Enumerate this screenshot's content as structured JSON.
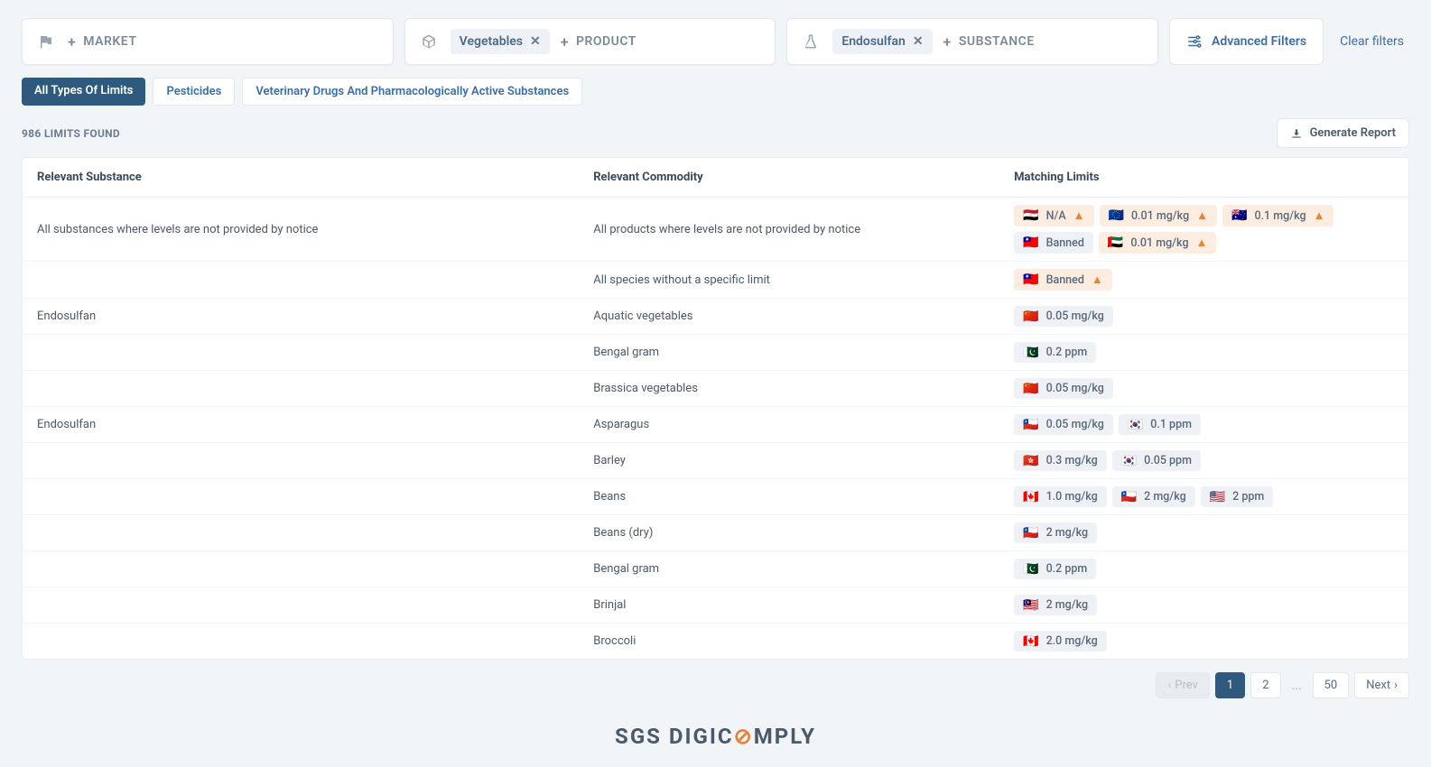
{
  "filters": {
    "market": {
      "placeholder": "MARKET"
    },
    "product": {
      "chip": "Vegetables",
      "placeholder": "PRODUCT"
    },
    "substance": {
      "chip": "Endosulfan",
      "placeholder": "SUBSTANCE"
    },
    "advanced_label": "Advanced Filters",
    "clear_label": "Clear filters"
  },
  "tabs": [
    {
      "label": "All Types Of Limits",
      "active": true
    },
    {
      "label": "Pesticides",
      "active": false
    },
    {
      "label": "Veterinary Drugs And Pharmacologically Active Substances",
      "active": false
    }
  ],
  "count_label": "986 LIMITS FOUND",
  "generate_label": "Generate Report",
  "columns": {
    "substance": "Relevant Substance",
    "commodity": "Relevant Commodity",
    "limits": "Matching Limits"
  },
  "rows": [
    {
      "substance": "All substances where levels are not provided by notice",
      "commodity": "All products where levels are not provided by notice",
      "limits": [
        {
          "flag": "🇪🇬",
          "value": "N/A",
          "warn": true
        },
        {
          "flag": "🇪🇺",
          "value": "0.01 mg/kg",
          "warn": true
        },
        {
          "flag": "🇦🇺",
          "value": "0.1 mg/kg",
          "warn": true
        },
        {
          "flag": "🇹🇼",
          "value": "Banned",
          "warn": false
        },
        {
          "flag": "🇦🇪",
          "value": "0.01 mg/kg",
          "warn": true
        }
      ]
    },
    {
      "substance": "",
      "commodity": "All species without a specific limit",
      "limits": [
        {
          "flag": "🇹🇼",
          "value": "Banned",
          "warn": true
        }
      ]
    },
    {
      "substance": "Endosulfan",
      "commodity": "Aquatic vegetables",
      "limits": [
        {
          "flag": "🇨🇳",
          "value": "0.05 mg/kg",
          "warn": false
        }
      ]
    },
    {
      "substance": "",
      "commodity": "Bengal gram",
      "limits": [
        {
          "flag": "🇵🇰",
          "value": "0.2 ppm",
          "warn": false
        }
      ]
    },
    {
      "substance": "",
      "commodity": "Brassica vegetables",
      "limits": [
        {
          "flag": "🇨🇳",
          "value": "0.05 mg/kg",
          "warn": false
        }
      ]
    },
    {
      "substance": "Endosulfan",
      "commodity": "Asparagus",
      "limits": [
        {
          "flag": "🇨🇱",
          "value": "0.05 mg/kg",
          "warn": false
        },
        {
          "flag": "🇰🇷",
          "value": "0.1 ppm",
          "warn": false
        }
      ]
    },
    {
      "substance": "",
      "commodity": "Barley",
      "limits": [
        {
          "flag": "🇭🇰",
          "value": "0.3 mg/kg",
          "warn": false
        },
        {
          "flag": "🇰🇷",
          "value": "0.05 ppm",
          "warn": false
        }
      ]
    },
    {
      "substance": "",
      "commodity": "Beans",
      "limits": [
        {
          "flag": "🇨🇦",
          "value": "1.0 mg/kg",
          "warn": false
        },
        {
          "flag": "🇨🇱",
          "value": "2 mg/kg",
          "warn": false
        },
        {
          "flag": "🇺🇸",
          "value": "2 ppm",
          "warn": false
        }
      ]
    },
    {
      "substance": "",
      "commodity": "Beans (dry)",
      "limits": [
        {
          "flag": "🇨🇱",
          "value": "2 mg/kg",
          "warn": false
        }
      ]
    },
    {
      "substance": "",
      "commodity": "Bengal gram",
      "limits": [
        {
          "flag": "🇵🇰",
          "value": "0.2 ppm",
          "warn": false
        }
      ]
    },
    {
      "substance": "",
      "commodity": "Brinjal",
      "limits": [
        {
          "flag": "🇲🇾",
          "value": "2 mg/kg",
          "warn": false
        }
      ]
    },
    {
      "substance": "",
      "commodity": "Broccoli",
      "limits": [
        {
          "flag": "🇨🇦",
          "value": "2.0 mg/kg",
          "warn": false
        }
      ]
    }
  ],
  "pagination": {
    "prev": "Prev",
    "pages": [
      "1",
      "2"
    ],
    "ellipsis": "...",
    "last": "50",
    "next": "Next",
    "active": "1"
  },
  "brand": {
    "part1": "SGS DIGIC",
    "symbol": "⊘",
    "part2": "MPLY"
  }
}
